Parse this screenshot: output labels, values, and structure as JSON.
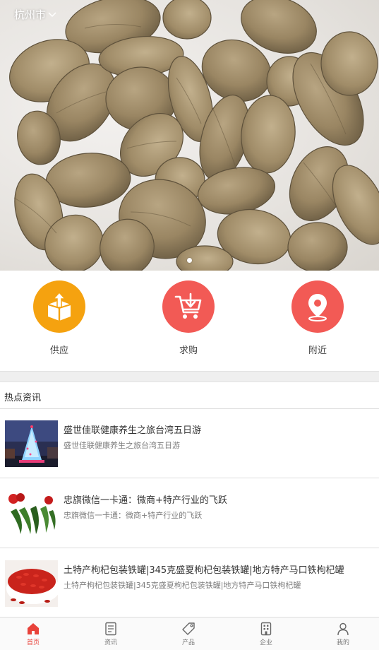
{
  "location": {
    "city": "杭州市"
  },
  "carousel": {
    "active_index": 0,
    "total": 1
  },
  "quick_links": [
    {
      "label": "供应",
      "icon": "box-upload-icon",
      "color": "#F5A20F"
    },
    {
      "label": "求购",
      "icon": "cart-download-icon",
      "color": "#F25A55"
    },
    {
      "label": "附近",
      "icon": "location-pin-icon",
      "color": "#F25A55"
    }
  ],
  "hot_news": {
    "title": "热点资讯",
    "items": [
      {
        "title": "盛世佳联健康养生之旅台湾五日游",
        "summary": "盛世佳联健康养生之旅台湾五日游",
        "thumb": "christmas-tree-photo"
      },
      {
        "title": "忠旗微信一卡通：微商+特产行业的飞跃",
        "summary": "忠旗微信一卡通：微商+特产行业的飞跃",
        "thumb": "okra-photo"
      },
      {
        "title": "土特产枸杞包装铁罐|345克盛夏枸杞包装铁罐|地方特产马口铁枸杞罐",
        "summary": "土特产枸杞包装铁罐|345克盛夏枸杞包装铁罐|地方特产马口铁枸杞罐",
        "thumb": "goji-berries-photo"
      }
    ]
  },
  "tabbar": {
    "active": "首页",
    "tabs": [
      {
        "label": "首页",
        "icon": "home-icon"
      },
      {
        "label": "资讯",
        "icon": "news-icon"
      },
      {
        "label": "产品",
        "icon": "tag-icon"
      },
      {
        "label": "企业",
        "icon": "building-icon"
      },
      {
        "label": "我的",
        "icon": "user-icon"
      }
    ]
  },
  "colors": {
    "accent": "#E8423A",
    "supply": "#F5A20F",
    "buy": "#F25A55"
  }
}
